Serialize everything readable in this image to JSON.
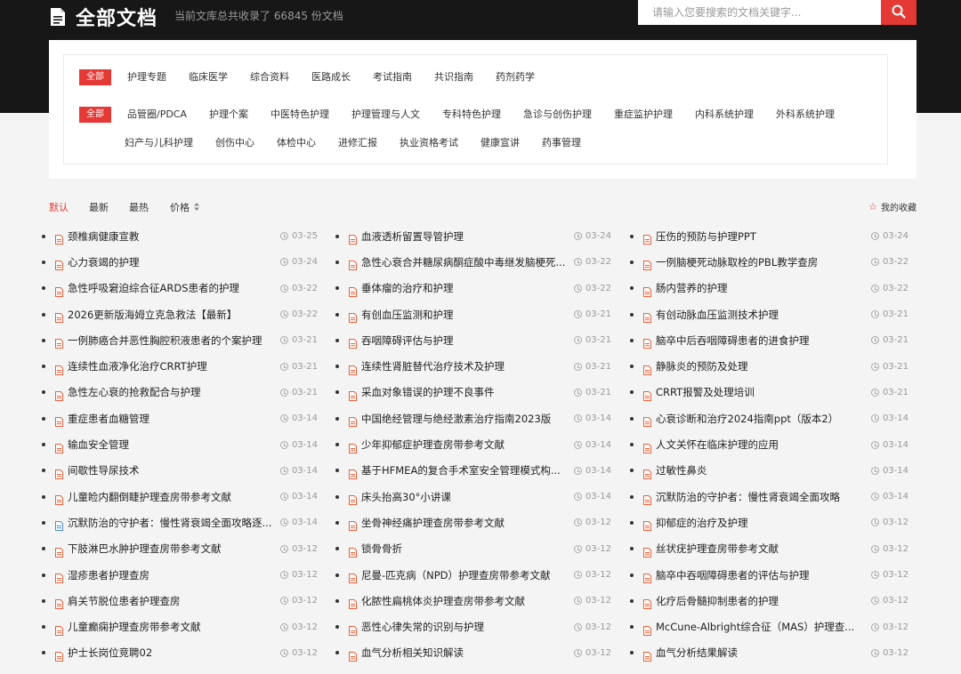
{
  "header": {
    "title": "全部文档",
    "subtitle": "当前文库总共收录了 66845 份文档",
    "search_placeholder": "请输入您要搜索的文档关键字..."
  },
  "filters": {
    "all_label": "全部",
    "row1": [
      "护理专题",
      "临床医学",
      "综合资料",
      "医路成长",
      "考试指南",
      "共识指南",
      "药剂药学"
    ],
    "row2": [
      "品管圈/PDCA",
      "护理个案",
      "中医特色护理",
      "护理管理与人文",
      "专科特色护理",
      "急诊与创伤护理",
      "重症监护护理",
      "内科系统护理",
      "外科系统护理"
    ],
    "row3": [
      "妇产与儿科护理",
      "创伤中心",
      "体检中心",
      "进修汇报",
      "执业资格考试",
      "健康宣讲",
      "药事管理"
    ]
  },
  "sort": {
    "default": "默认",
    "latest": "最新",
    "hottest": "最热",
    "price": "价格",
    "favorites": "我的收藏"
  },
  "columns": [
    [
      {
        "title": "颈椎病健康宣教",
        "date": "03-25",
        "icon": "pdf"
      },
      {
        "title": "心力衰竭的护理",
        "date": "03-24",
        "icon": "pdf"
      },
      {
        "title": "急性呼吸窘迫综合征ARDS患者的护理",
        "date": "03-22",
        "icon": "pdf"
      },
      {
        "title": "2026更新版海姆立克急救法【最新】",
        "date": "03-22",
        "icon": "pdf"
      },
      {
        "title": "一例肺癌合并恶性胸腔积液患者的个案护理",
        "date": "03-21",
        "icon": "pdf"
      },
      {
        "title": "连续性血液净化治疗CRRT护理",
        "date": "03-21",
        "icon": "pdf"
      },
      {
        "title": "急性左心衰的抢救配合与护理",
        "date": "03-21",
        "icon": "pdf"
      },
      {
        "title": "重症患者血糖管理",
        "date": "03-14",
        "icon": "pdf"
      },
      {
        "title": "输血安全管理",
        "date": "03-14",
        "icon": "pdf"
      },
      {
        "title": "间歇性导尿技术",
        "date": "03-14",
        "icon": "pdf"
      },
      {
        "title": "儿童睑内翻倒睫护理查房带参考文献",
        "date": "03-14",
        "icon": "pdf"
      },
      {
        "title": "沉默防治的守护者：慢性肾衰竭全面攻略逐...",
        "date": "03-14",
        "icon": "doc"
      },
      {
        "title": "下肢淋巴水肿护理查房带参考文献",
        "date": "03-12",
        "icon": "pdf"
      },
      {
        "title": "湿疹患者护理查房",
        "date": "03-12",
        "icon": "pdf"
      },
      {
        "title": "肩关节脱位患者护理查房",
        "date": "03-12",
        "icon": "pdf"
      },
      {
        "title": "儿童癫痫护理查房带参考文献",
        "date": "03-12",
        "icon": "pdf"
      },
      {
        "title": "护士长岗位竞聘02",
        "date": "03-12",
        "icon": "pdf"
      }
    ],
    [
      {
        "title": "血液透析留置导管护理",
        "date": "03-24",
        "icon": "pdf"
      },
      {
        "title": "急性心衰合并糖尿病酮症酸中毒继发脑梗死...",
        "date": "03-22",
        "icon": "pdf"
      },
      {
        "title": "垂体瘤的治疗和护理",
        "date": "03-22",
        "icon": "pdf"
      },
      {
        "title": "有创血压监测和护理",
        "date": "03-21",
        "icon": "pdf"
      },
      {
        "title": "吞咽障碍评估与护理",
        "date": "03-21",
        "icon": "pdf"
      },
      {
        "title": "连续性肾脏替代治疗技术及护理",
        "date": "03-21",
        "icon": "pdf"
      },
      {
        "title": "采血对象错误的护理不良事件",
        "date": "03-21",
        "icon": "pdf"
      },
      {
        "title": "中国绝经管理与绝经激素治疗指南2023版",
        "date": "03-14",
        "icon": "pdf"
      },
      {
        "title": "少年抑郁症护理查房带参考文献",
        "date": "03-14",
        "icon": "pdf"
      },
      {
        "title": "基于HFMEA的复合手术室安全管理模式构...",
        "date": "03-14",
        "icon": "pdf"
      },
      {
        "title": "床头抬高30°小讲课",
        "date": "03-14",
        "icon": "pdf"
      },
      {
        "title": "坐骨神经痛护理查房带参考文献",
        "date": "03-12",
        "icon": "pdf"
      },
      {
        "title": "锁骨骨折",
        "date": "03-12",
        "icon": "pdf"
      },
      {
        "title": "尼曼-匹克病（NPD）护理查房带参考文献",
        "date": "03-12",
        "icon": "pdf"
      },
      {
        "title": "化脓性扁桃体炎护理查房带参考文献",
        "date": "03-12",
        "icon": "pdf"
      },
      {
        "title": "恶性心律失常的识别与护理",
        "date": "03-12",
        "icon": "pdf"
      },
      {
        "title": "血气分析相关知识解读",
        "date": "03-12",
        "icon": "pdf"
      }
    ],
    [
      {
        "title": "压伤的预防与护理PPT",
        "date": "03-24",
        "icon": "pdf"
      },
      {
        "title": "一例脑梗死动脉取栓的PBL教学查房",
        "date": "03-22",
        "icon": "pdf"
      },
      {
        "title": "肠内营养的护理",
        "date": "03-22",
        "icon": "pdf"
      },
      {
        "title": "有创动脉血压监测技术护理",
        "date": "03-21",
        "icon": "pdf"
      },
      {
        "title": "脑卒中后吞咽障碍患者的进食护理",
        "date": "03-21",
        "icon": "pdf"
      },
      {
        "title": "静脉炎的预防及处理",
        "date": "03-21",
        "icon": "pdf"
      },
      {
        "title": "CRRT报警及处理培训",
        "date": "03-21",
        "icon": "pdf"
      },
      {
        "title": "心衰诊断和治疗2024指南ppt（版本2）",
        "date": "03-14",
        "icon": "pdf"
      },
      {
        "title": "人文关怀在临床护理的应用",
        "date": "03-14",
        "icon": "pdf"
      },
      {
        "title": "过敏性鼻炎",
        "date": "03-14",
        "icon": "pdf"
      },
      {
        "title": "沉默防治的守护者：慢性肾衰竭全面攻略",
        "date": "03-14",
        "icon": "pdf"
      },
      {
        "title": "抑郁症的治疗及护理",
        "date": "03-12",
        "icon": "pdf"
      },
      {
        "title": "丝状疣护理查房带参考文献",
        "date": "03-12",
        "icon": "pdf"
      },
      {
        "title": "脑卒中吞咽障碍患者的评估与护理",
        "date": "03-12",
        "icon": "pdf"
      },
      {
        "title": "化疗后骨髓抑制患者的护理",
        "date": "03-12",
        "icon": "pdf"
      },
      {
        "title": "McCune-Albright综合征（MAS）护理查...",
        "date": "03-12",
        "icon": "pdf"
      },
      {
        "title": "血气分析结果解读",
        "date": "03-12",
        "icon": "pdf"
      }
    ]
  ],
  "colors": {
    "accent": "#e53935",
    "header_bg": "#171717",
    "pdf_icon": "#e8613c",
    "doc_icon": "#4a8fd9"
  }
}
